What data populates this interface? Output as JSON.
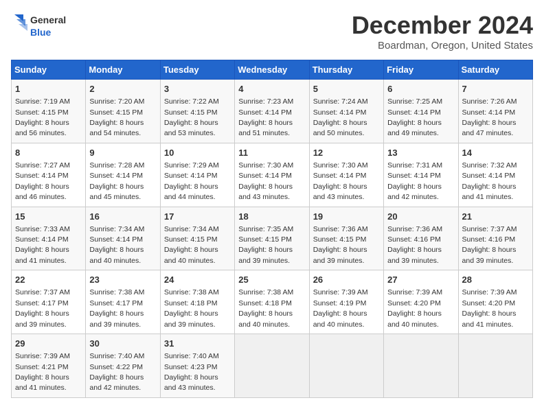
{
  "header": {
    "logo_line1": "General",
    "logo_line2": "Blue",
    "title": "December 2024",
    "subtitle": "Boardman, Oregon, United States"
  },
  "days_of_week": [
    "Sunday",
    "Monday",
    "Tuesday",
    "Wednesday",
    "Thursday",
    "Friday",
    "Saturday"
  ],
  "weeks": [
    [
      {
        "day": "1",
        "sunrise": "7:19 AM",
        "sunset": "4:15 PM",
        "daylight": "8 hours and 56 minutes."
      },
      {
        "day": "2",
        "sunrise": "7:20 AM",
        "sunset": "4:15 PM",
        "daylight": "8 hours and 54 minutes."
      },
      {
        "day": "3",
        "sunrise": "7:22 AM",
        "sunset": "4:15 PM",
        "daylight": "8 hours and 53 minutes."
      },
      {
        "day": "4",
        "sunrise": "7:23 AM",
        "sunset": "4:14 PM",
        "daylight": "8 hours and 51 minutes."
      },
      {
        "day": "5",
        "sunrise": "7:24 AM",
        "sunset": "4:14 PM",
        "daylight": "8 hours and 50 minutes."
      },
      {
        "day": "6",
        "sunrise": "7:25 AM",
        "sunset": "4:14 PM",
        "daylight": "8 hours and 49 minutes."
      },
      {
        "day": "7",
        "sunrise": "7:26 AM",
        "sunset": "4:14 PM",
        "daylight": "8 hours and 47 minutes."
      }
    ],
    [
      {
        "day": "8",
        "sunrise": "7:27 AM",
        "sunset": "4:14 PM",
        "daylight": "8 hours and 46 minutes."
      },
      {
        "day": "9",
        "sunrise": "7:28 AM",
        "sunset": "4:14 PM",
        "daylight": "8 hours and 45 minutes."
      },
      {
        "day": "10",
        "sunrise": "7:29 AM",
        "sunset": "4:14 PM",
        "daylight": "8 hours and 44 minutes."
      },
      {
        "day": "11",
        "sunrise": "7:30 AM",
        "sunset": "4:14 PM",
        "daylight": "8 hours and 43 minutes."
      },
      {
        "day": "12",
        "sunrise": "7:30 AM",
        "sunset": "4:14 PM",
        "daylight": "8 hours and 43 minutes."
      },
      {
        "day": "13",
        "sunrise": "7:31 AM",
        "sunset": "4:14 PM",
        "daylight": "8 hours and 42 minutes."
      },
      {
        "day": "14",
        "sunrise": "7:32 AM",
        "sunset": "4:14 PM",
        "daylight": "8 hours and 41 minutes."
      }
    ],
    [
      {
        "day": "15",
        "sunrise": "7:33 AM",
        "sunset": "4:14 PM",
        "daylight": "8 hours and 41 minutes."
      },
      {
        "day": "16",
        "sunrise": "7:34 AM",
        "sunset": "4:14 PM",
        "daylight": "8 hours and 40 minutes."
      },
      {
        "day": "17",
        "sunrise": "7:34 AM",
        "sunset": "4:15 PM",
        "daylight": "8 hours and 40 minutes."
      },
      {
        "day": "18",
        "sunrise": "7:35 AM",
        "sunset": "4:15 PM",
        "daylight": "8 hours and 39 minutes."
      },
      {
        "day": "19",
        "sunrise": "7:36 AM",
        "sunset": "4:15 PM",
        "daylight": "8 hours and 39 minutes."
      },
      {
        "day": "20",
        "sunrise": "7:36 AM",
        "sunset": "4:16 PM",
        "daylight": "8 hours and 39 minutes."
      },
      {
        "day": "21",
        "sunrise": "7:37 AM",
        "sunset": "4:16 PM",
        "daylight": "8 hours and 39 minutes."
      }
    ],
    [
      {
        "day": "22",
        "sunrise": "7:37 AM",
        "sunset": "4:17 PM",
        "daylight": "8 hours and 39 minutes."
      },
      {
        "day": "23",
        "sunrise": "7:38 AM",
        "sunset": "4:17 PM",
        "daylight": "8 hours and 39 minutes."
      },
      {
        "day": "24",
        "sunrise": "7:38 AM",
        "sunset": "4:18 PM",
        "daylight": "8 hours and 39 minutes."
      },
      {
        "day": "25",
        "sunrise": "7:38 AM",
        "sunset": "4:18 PM",
        "daylight": "8 hours and 40 minutes."
      },
      {
        "day": "26",
        "sunrise": "7:39 AM",
        "sunset": "4:19 PM",
        "daylight": "8 hours and 40 minutes."
      },
      {
        "day": "27",
        "sunrise": "7:39 AM",
        "sunset": "4:20 PM",
        "daylight": "8 hours and 40 minutes."
      },
      {
        "day": "28",
        "sunrise": "7:39 AM",
        "sunset": "4:20 PM",
        "daylight": "8 hours and 41 minutes."
      }
    ],
    [
      {
        "day": "29",
        "sunrise": "7:39 AM",
        "sunset": "4:21 PM",
        "daylight": "8 hours and 41 minutes."
      },
      {
        "day": "30",
        "sunrise": "7:40 AM",
        "sunset": "4:22 PM",
        "daylight": "8 hours and 42 minutes."
      },
      {
        "day": "31",
        "sunrise": "7:40 AM",
        "sunset": "4:23 PM",
        "daylight": "8 hours and 43 minutes."
      },
      null,
      null,
      null,
      null
    ]
  ],
  "labels": {
    "sunrise": "Sunrise:",
    "sunset": "Sunset:",
    "daylight": "Daylight hours"
  }
}
